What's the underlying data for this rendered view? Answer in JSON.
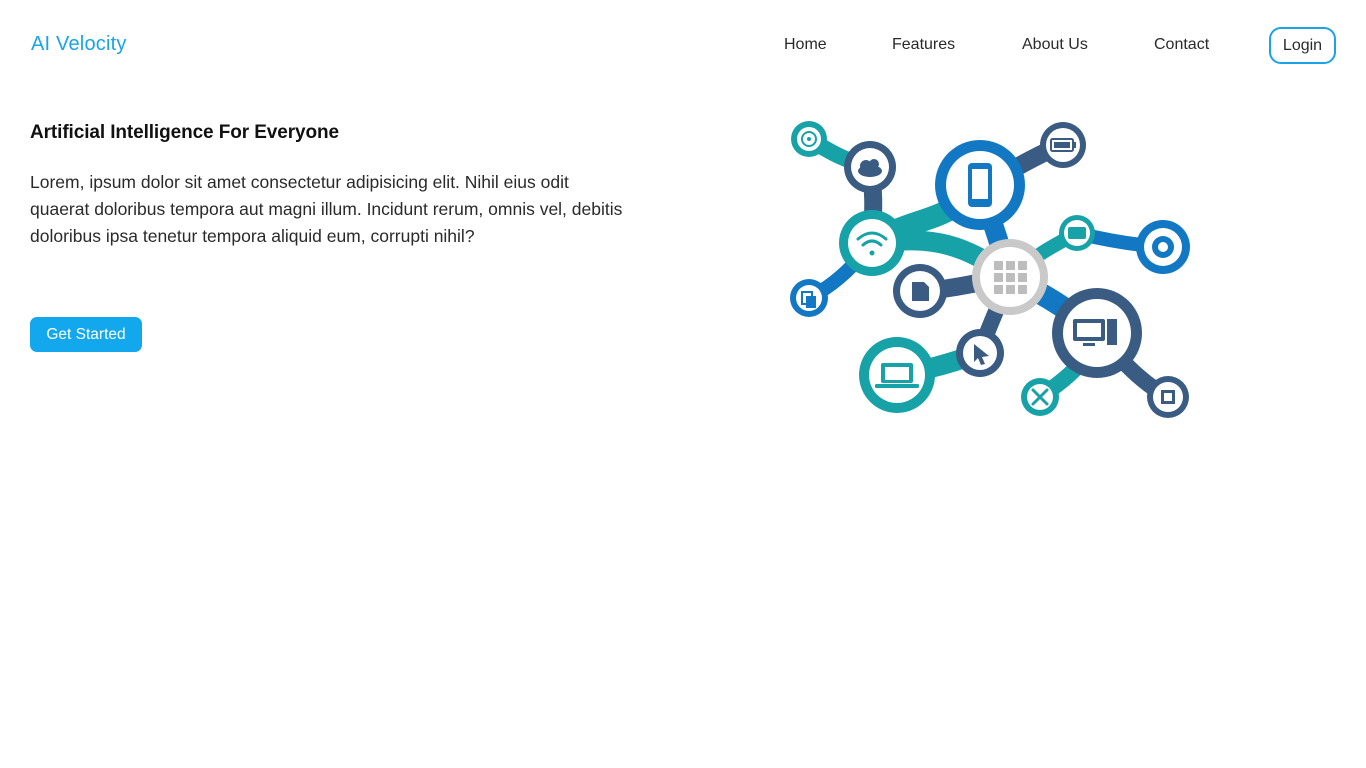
{
  "brand": {
    "name": "AI Velocity"
  },
  "nav": {
    "home": "Home",
    "features": "Features",
    "about": "About Us",
    "contact": "Contact",
    "login": "Login"
  },
  "hero": {
    "title": "Artificial Intelligence For Everyone",
    "body": "Lorem, ipsum dolor sit amet consectetur adipisicing elit. Nihil eius odit quaerat doloribus tempora aut magni illum. Incidunt rerum, omnis vel, debitis doloribus ipsa tenetur tempora aliquid eum, corrupti nihil?",
    "cta": "Get Started"
  },
  "illustration": {
    "icons": [
      "disc-icon",
      "cloud-icon",
      "smartphone-icon",
      "battery-icon",
      "wifi-icon",
      "keyboard-icon",
      "gear-icon",
      "grid-icon",
      "sd-card-icon",
      "copy-icon",
      "monitor-icon",
      "cursor-icon",
      "laptop-icon",
      "tools-icon",
      "chip-icon"
    ]
  },
  "colors": {
    "accent": "#1aa3e8",
    "button": "#13a8ee",
    "teal": "#17a2a8",
    "navy": "#3a5b82",
    "blue": "#1278c3"
  }
}
